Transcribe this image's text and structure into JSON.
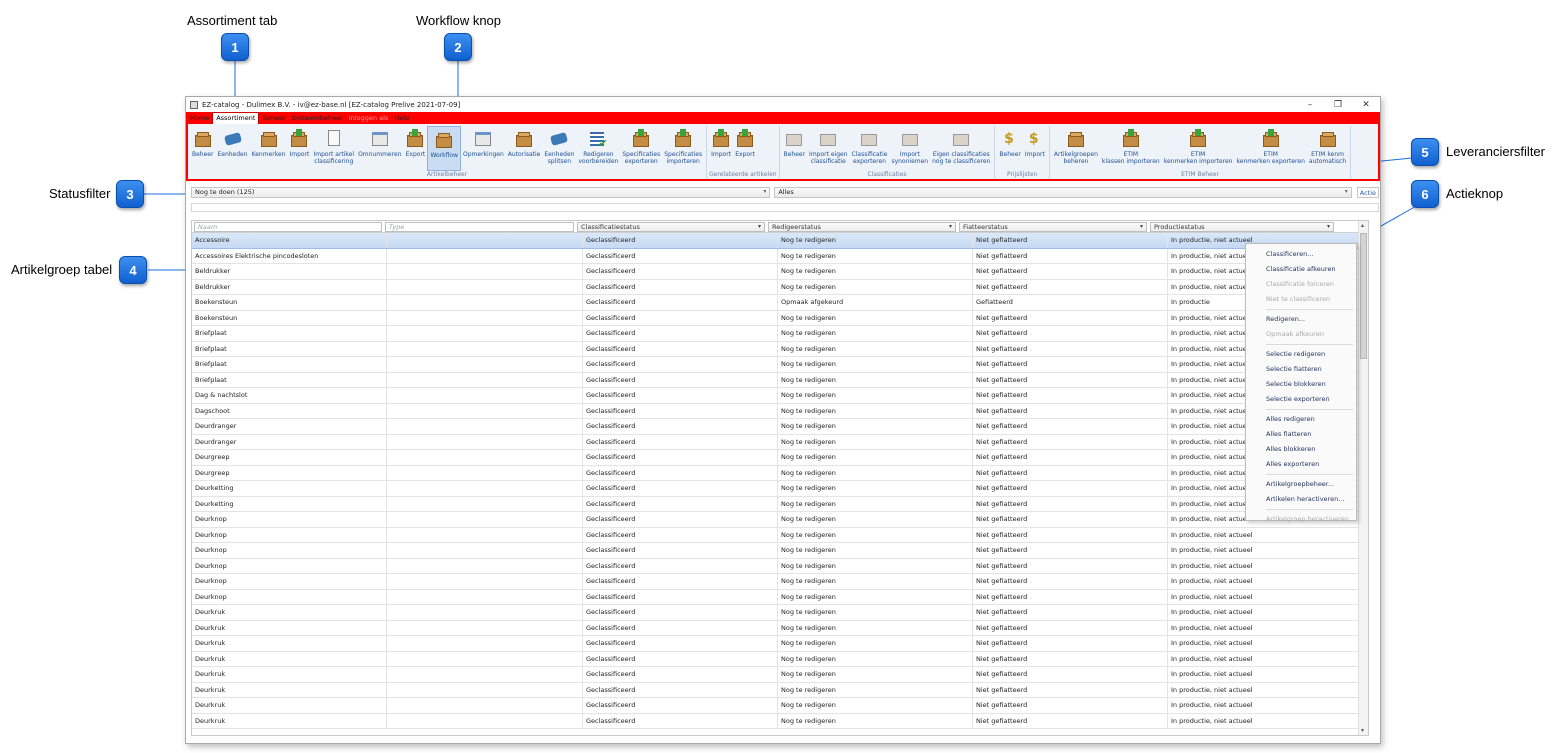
{
  "callouts": [
    {
      "number": "1",
      "label": "Assortiment tab"
    },
    {
      "number": "2",
      "label": "Workflow knop"
    },
    {
      "number": "3",
      "label": "Statusfilter"
    },
    {
      "number": "4",
      "label": "Artikelgroep tabel"
    },
    {
      "number": "5",
      "label": "Leveranciersfilter"
    },
    {
      "number": "6",
      "label": "Actieknop"
    }
  ],
  "window": {
    "title": "EZ-catalog - Dulimex B.V. - iv@ez-base.nl [EZ-catalog Prelive 2021-07-09]",
    "controls": {
      "minimize": "–",
      "maximize": "❐",
      "close": "✕"
    }
  },
  "menu_tabs": [
    {
      "label": "Home",
      "active": false,
      "dim": false
    },
    {
      "label": "Assortiment",
      "active": true,
      "dim": false
    },
    {
      "label": "Beheer",
      "active": false,
      "dim": false
    },
    {
      "label": "Systeembeheer",
      "active": false,
      "dim": false
    },
    {
      "label": "Inloggen als",
      "active": false,
      "dim": true
    },
    {
      "label": "Help",
      "active": false,
      "dim": false
    }
  ],
  "ribbon": {
    "groups": [
      {
        "label": "Artikelbeheer",
        "buttons": [
          {
            "label": "Beheer",
            "icon": "box-icon"
          },
          {
            "label": "Eenheden",
            "icon": "tools-icon"
          },
          {
            "label": "Kenmerken",
            "icon": "box-icon"
          },
          {
            "label": "Import",
            "icon": "box-arrow-icon"
          },
          {
            "label": "Import artikel\nclassificering",
            "icon": "page-icon"
          },
          {
            "label": "Omnummeren",
            "icon": "window-icon"
          },
          {
            "label": "Export",
            "icon": "box-arrow-icon"
          },
          {
            "label": "Workflow",
            "icon": "workflow-icon",
            "selected": true
          },
          {
            "label": "Opmerkingen",
            "icon": "window-icon"
          },
          {
            "label": "Autorisatie",
            "icon": "box-icon"
          },
          {
            "label": "Eenheden\nsplitsen",
            "icon": "tools-icon"
          },
          {
            "label": "Redigeren\nvoorbereiden",
            "icon": "list-check-icon"
          },
          {
            "label": "Specificaties\nexporteren",
            "icon": "box-arrow-icon"
          },
          {
            "label": "Specificaties\nimporteren",
            "icon": "box-arrow-icon"
          }
        ]
      },
      {
        "label": "Gerelateerde artikelen",
        "buttons": [
          {
            "label": "Import",
            "icon": "box-arrow-icon"
          },
          {
            "label": "Export",
            "icon": "box-arrow-icon"
          }
        ]
      },
      {
        "label": "Classificaties",
        "buttons": [
          {
            "label": "Beheer",
            "icon": "folder-icon"
          },
          {
            "label": "Import eigen\nclassificatie",
            "icon": "folder-icon"
          },
          {
            "label": "Classificatie\nexporteren",
            "icon": "folder-icon"
          },
          {
            "label": "Import\nsynoniemen",
            "icon": "folder-icon"
          },
          {
            "label": "Eigen classificaties\nnog te classificeren",
            "icon": "folder-icon"
          }
        ]
      },
      {
        "label": "Prijslijsten",
        "buttons": [
          {
            "label": "Beheer",
            "icon": "dollar-icon"
          },
          {
            "label": "Import",
            "icon": "dollar-icon"
          }
        ]
      },
      {
        "label": "ETIM Beheer",
        "buttons": [
          {
            "label": "Artikelgroepen\nbeheren",
            "icon": "box-icon"
          },
          {
            "label": "ETIM\nklassen importeren",
            "icon": "box-arrow-icon"
          },
          {
            "label": "ETIM\nkenmerken importeren",
            "icon": "box-arrow-icon"
          },
          {
            "label": "ETIM\nkenmerken exporteren",
            "icon": "box-arrow-icon"
          },
          {
            "label": "ETIM kenm\nautomatisch",
            "icon": "box-icon"
          }
        ]
      }
    ]
  },
  "filters": {
    "status": "Nog te doen (125)",
    "supplier": "Alles",
    "action_button": "Actie"
  },
  "table": {
    "filter_placeholders": [
      "Naam",
      "Type"
    ],
    "columns": [
      "Classificatiestatus",
      "Redigeerstatus",
      "Fiatteerstatus",
      "Productiestatus"
    ],
    "rows": [
      [
        "Accessoire",
        "",
        "Geclassificeerd",
        "Nog te redigeren",
        "Niet gefiatteerd",
        "In productie, niet actueel"
      ],
      [
        "Accessoires Elektrische pincodesloten",
        "",
        "Geclassificeerd",
        "Nog te redigeren",
        "Niet gefiatteerd",
        "In productie, niet actueel"
      ],
      [
        "Beldrukker",
        "",
        "Geclassificeerd",
        "Nog te redigeren",
        "Niet gefiatteerd",
        "In productie, niet actueel"
      ],
      [
        "Beldrukker",
        "",
        "Geclassificeerd",
        "Nog te redigeren",
        "Niet gefiatteerd",
        "In productie, niet actueel"
      ],
      [
        "Boekensteun",
        "",
        "Geclassificeerd",
        "Opmaak afgekeurd",
        "Gefiatteerd",
        "In productie"
      ],
      [
        "Boekensteun",
        "",
        "Geclassificeerd",
        "Nog te redigeren",
        "Niet gefiatteerd",
        "In productie, niet actueel"
      ],
      [
        "Briefplaat",
        "",
        "Geclassificeerd",
        "Nog te redigeren",
        "Niet gefiatteerd",
        "In productie, niet actueel"
      ],
      [
        "Briefplaat",
        "",
        "Geclassificeerd",
        "Nog te redigeren",
        "Niet gefiatteerd",
        "In productie, niet actueel"
      ],
      [
        "Briefplaat",
        "",
        "Geclassificeerd",
        "Nog te redigeren",
        "Niet gefiatteerd",
        "In productie, niet actueel"
      ],
      [
        "Briefplaat",
        "",
        "Geclassificeerd",
        "Nog te redigeren",
        "Niet gefiatteerd",
        "In productie, niet actueel"
      ],
      [
        "Dag & nachtslot",
        "",
        "Geclassificeerd",
        "Nog te redigeren",
        "Niet gefiatteerd",
        "In productie, niet actueel"
      ],
      [
        "Dagschoot",
        "",
        "Geclassificeerd",
        "Nog te redigeren",
        "Niet gefiatteerd",
        "In productie, niet actueel"
      ],
      [
        "Deurdranger",
        "",
        "Geclassificeerd",
        "Nog te redigeren",
        "Niet gefiatteerd",
        "In productie, niet actueel"
      ],
      [
        "Deurdranger",
        "",
        "Geclassificeerd",
        "Nog te redigeren",
        "Niet gefiatteerd",
        "In productie, niet actueel"
      ],
      [
        "Deurgreep",
        "",
        "Geclassificeerd",
        "Nog te redigeren",
        "Niet gefiatteerd",
        "In productie, niet actueel"
      ],
      [
        "Deurgreep",
        "",
        "Geclassificeerd",
        "Nog te redigeren",
        "Niet gefiatteerd",
        "In productie, niet actueel"
      ],
      [
        "Deurketting",
        "",
        "Geclassificeerd",
        "Nog te redigeren",
        "Niet gefiatteerd",
        "In productie, niet actueel"
      ],
      [
        "Deurketting",
        "",
        "Geclassificeerd",
        "Nog te redigeren",
        "Niet gefiatteerd",
        "In productie, niet actueel"
      ],
      [
        "Deurknop",
        "",
        "Geclassificeerd",
        "Nog te redigeren",
        "Niet gefiatteerd",
        "In productie, niet actueel"
      ],
      [
        "Deurknop",
        "",
        "Geclassificeerd",
        "Nog te redigeren",
        "Niet gefiatteerd",
        "In productie, niet actueel"
      ],
      [
        "Deurknop",
        "",
        "Geclassificeerd",
        "Nog te redigeren",
        "Niet gefiatteerd",
        "In productie, niet actueel"
      ],
      [
        "Deurknop",
        "",
        "Geclassificeerd",
        "Nog te redigeren",
        "Niet gefiatteerd",
        "In productie, niet actueel"
      ],
      [
        "Deurknop",
        "",
        "Geclassificeerd",
        "Nog te redigeren",
        "Niet gefiatteerd",
        "In productie, niet actueel"
      ],
      [
        "Deurknop",
        "",
        "Geclassificeerd",
        "Nog te redigeren",
        "Niet gefiatteerd",
        "In productie, niet actueel"
      ],
      [
        "Deurkruk",
        "",
        "Geclassificeerd",
        "Nog te redigeren",
        "Niet gefiatteerd",
        "In productie, niet actueel"
      ],
      [
        "Deurkruk",
        "",
        "Geclassificeerd",
        "Nog te redigeren",
        "Niet gefiatteerd",
        "In productie, niet actueel"
      ],
      [
        "Deurkruk",
        "",
        "Geclassificeerd",
        "Nog te redigeren",
        "Niet gefiatteerd",
        "In productie, niet actueel"
      ],
      [
        "Deurkruk",
        "",
        "Geclassificeerd",
        "Nog te redigeren",
        "Niet gefiatteerd",
        "In productie, niet actueel"
      ],
      [
        "Deurkruk",
        "",
        "Geclassificeerd",
        "Nog te redigeren",
        "Niet gefiatteerd",
        "In productie, niet actueel"
      ],
      [
        "Deurkruk",
        "",
        "Geclassificeerd",
        "Nog te redigeren",
        "Niet gefiatteerd",
        "In productie, niet actueel"
      ],
      [
        "Deurkruk",
        "",
        "Geclassificeerd",
        "Nog te redigeren",
        "Niet gefiatteerd",
        "In productie, niet actueel"
      ],
      [
        "Deurkruk",
        "",
        "Geclassificeerd",
        "Nog te redigeren",
        "Niet gefiatteerd",
        "In productie, niet actueel"
      ]
    ]
  },
  "context_menu": [
    {
      "label": "Classificeren...",
      "disabled": false
    },
    {
      "label": "Classificatie afkeuren",
      "disabled": false
    },
    {
      "label": "Classificatie forceren",
      "disabled": true
    },
    {
      "label": "Niet te classificeren",
      "disabled": true
    },
    {
      "separator": true
    },
    {
      "label": "Redigeren...",
      "disabled": false
    },
    {
      "label": "Opmaak afkeuren",
      "disabled": true
    },
    {
      "separator": true
    },
    {
      "label": "Selectie redigeren",
      "disabled": false
    },
    {
      "label": "Selectie fiatteren",
      "disabled": false
    },
    {
      "label": "Selectie blokkeren",
      "disabled": false
    },
    {
      "label": "Selectie exporteren",
      "disabled": false
    },
    {
      "separator": true
    },
    {
      "label": "Alles redigeren",
      "disabled": false
    },
    {
      "label": "Alles fiatteren",
      "disabled": false
    },
    {
      "label": "Alles blokkeren",
      "disabled": false
    },
    {
      "label": "Alles exporteren",
      "disabled": false
    },
    {
      "separator": true
    },
    {
      "label": "Artikelgroepbeheer...",
      "disabled": false
    },
    {
      "label": "Artikelen heractiveren...",
      "disabled": false
    },
    {
      "separator": true
    },
    {
      "label": "Artikelgroep heractiveren",
      "disabled": true
    }
  ],
  "colors": {
    "accent_red": "#ff0000",
    "callout_blue": "#1b6fe0",
    "selection": "#c5daf4"
  }
}
